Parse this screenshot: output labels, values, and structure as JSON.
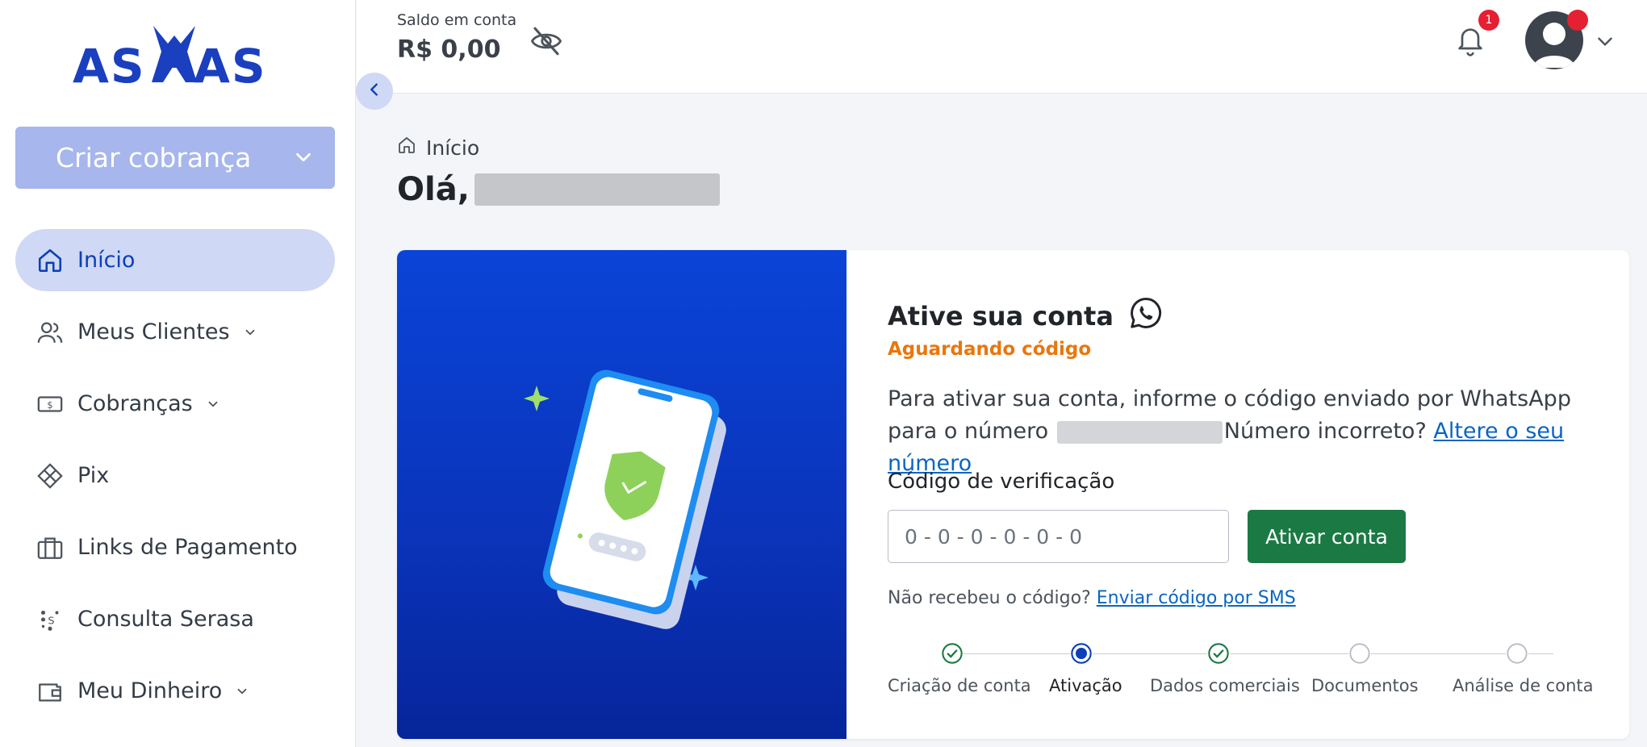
{
  "brand": {
    "logo_text": "ASAAS",
    "color": "#0a3fb8"
  },
  "sidebar": {
    "create_button": "Criar cobrança",
    "items": [
      {
        "label": "Início",
        "icon": "home-icon",
        "active": true,
        "has_dropdown": false
      },
      {
        "label": "Meus Clientes",
        "icon": "users-icon",
        "active": false,
        "has_dropdown": true
      },
      {
        "label": "Cobranças",
        "icon": "bill-icon",
        "active": false,
        "has_dropdown": true
      },
      {
        "label": "Pix",
        "icon": "pix-icon",
        "active": false,
        "has_dropdown": false
      },
      {
        "label": "Links de Pagamento",
        "icon": "briefcase-icon",
        "active": false,
        "has_dropdown": false
      },
      {
        "label": "Consulta Serasa",
        "icon": "serasa-icon",
        "active": false,
        "has_dropdown": false
      },
      {
        "label": "Meu Dinheiro",
        "icon": "wallet-icon",
        "active": false,
        "has_dropdown": true
      }
    ]
  },
  "topbar": {
    "balance_label": "Saldo em conta",
    "balance_value": "R$ 0,00",
    "notification_count": "1"
  },
  "main": {
    "breadcrumb": "Início",
    "greeting": "Olá,"
  },
  "activation": {
    "title": "Ative sua conta",
    "status": "Aguardando código",
    "description_prefix": "Para ativar sua conta, informe o código enviado por WhatsApp para o número",
    "description_wrong": "Número incorreto?",
    "change_link": "Altere o seu número",
    "code_label": "Código de verificação",
    "code_placeholder": "0 - 0 - 0 - 0 - 0 - 0",
    "code_value": "",
    "activate_button": "Ativar conta",
    "resend_prefix": "Não recebeu o código?",
    "resend_link": "Enviar código por SMS",
    "steps": [
      {
        "label": "Criação de conta",
        "state": "done"
      },
      {
        "label": "Ativação",
        "state": "current"
      },
      {
        "label": "Dados comerciais",
        "state": "done"
      },
      {
        "label": "Documentos",
        "state": "pending"
      },
      {
        "label": "Análise de conta",
        "state": "pending"
      }
    ]
  },
  "colors": {
    "primary": "#0a3fb8",
    "status_orange": "#e8770e",
    "success_green": "#1b7a44",
    "link_blue": "#0a66c2",
    "badge_red": "#e42032"
  }
}
